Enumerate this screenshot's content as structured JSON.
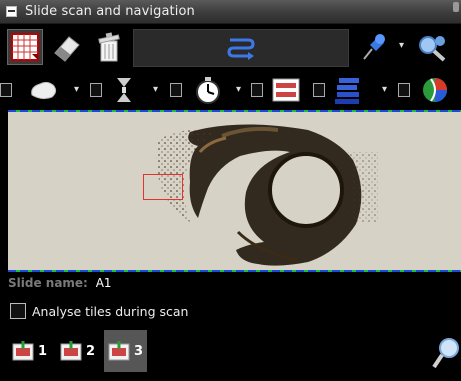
{
  "window": {
    "title": "Slide scan and navigation"
  },
  "info": {
    "slide_name_label": "Slide name:",
    "slide_name_value": "A1",
    "analyse_label": "Analyse tiles during scan",
    "analyse_checked": false
  },
  "tiles": [
    {
      "label": "1",
      "selected": false
    },
    {
      "label": "2",
      "selected": false
    },
    {
      "label": "3",
      "selected": true
    }
  ],
  "colors": {
    "accent_blue": "#1b4bd6",
    "accent_green": "#14c24a",
    "selection_red": "#e83030",
    "pin_blue": "#3a78e0"
  },
  "icons": {
    "row1": [
      "grid-scan-icon",
      "eraser-icon",
      "trash-icon",
      "route-icon",
      "pin-icon",
      "search-zoom-icon"
    ],
    "row2": [
      "tissue-detect-icon",
      "focus-z-icon",
      "timer-icon",
      "region-icon",
      "stack-icon",
      "color-balance-icon"
    ]
  }
}
